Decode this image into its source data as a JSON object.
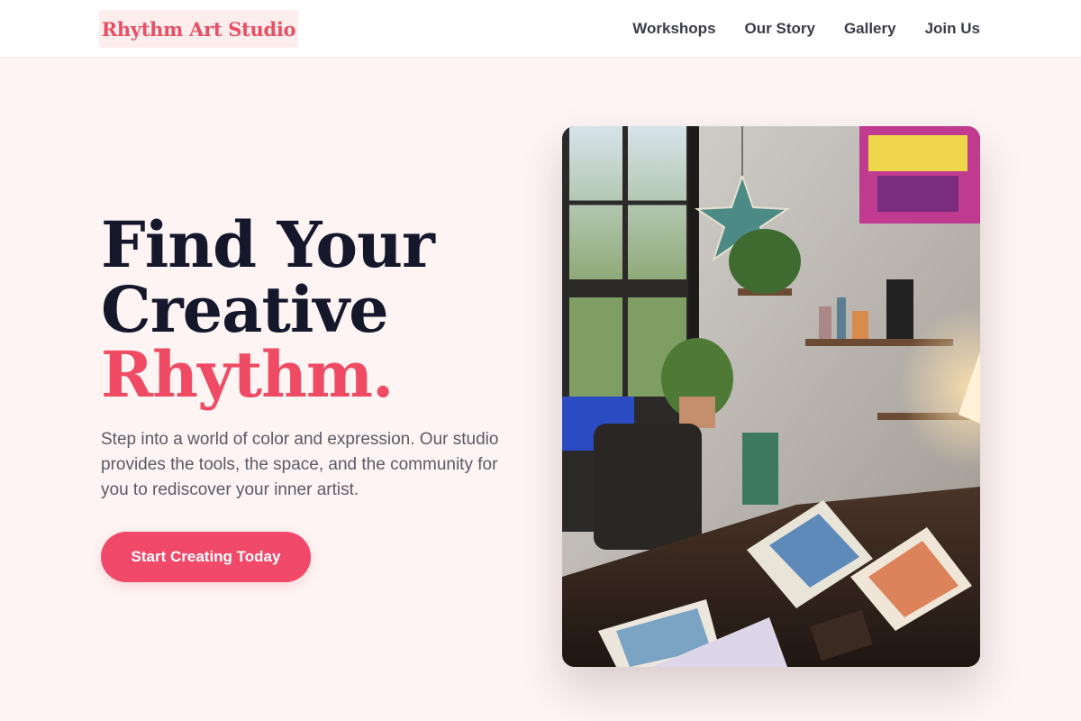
{
  "header": {
    "logo_text": "Rhythm Art Studio",
    "nav": [
      {
        "label": "Workshops"
      },
      {
        "label": "Our Story"
      },
      {
        "label": "Gallery"
      },
      {
        "label": "Join Us"
      }
    ]
  },
  "hero": {
    "title_line1": "Find Your",
    "title_line2": "Creative",
    "title_accent": "Rhythm.",
    "description": "Step into a world of color and expression. Our studio provides the tools, the space, and the community for you to rediscover your inner artist.",
    "cta_label": "Start Creating Today",
    "image_alt": "Art studio interior with plants, shelves of supplies and open sketchbooks on a desk"
  },
  "colors": {
    "accent": "#ef4b64",
    "heading": "#15172b",
    "background": "#fdf4f3"
  }
}
